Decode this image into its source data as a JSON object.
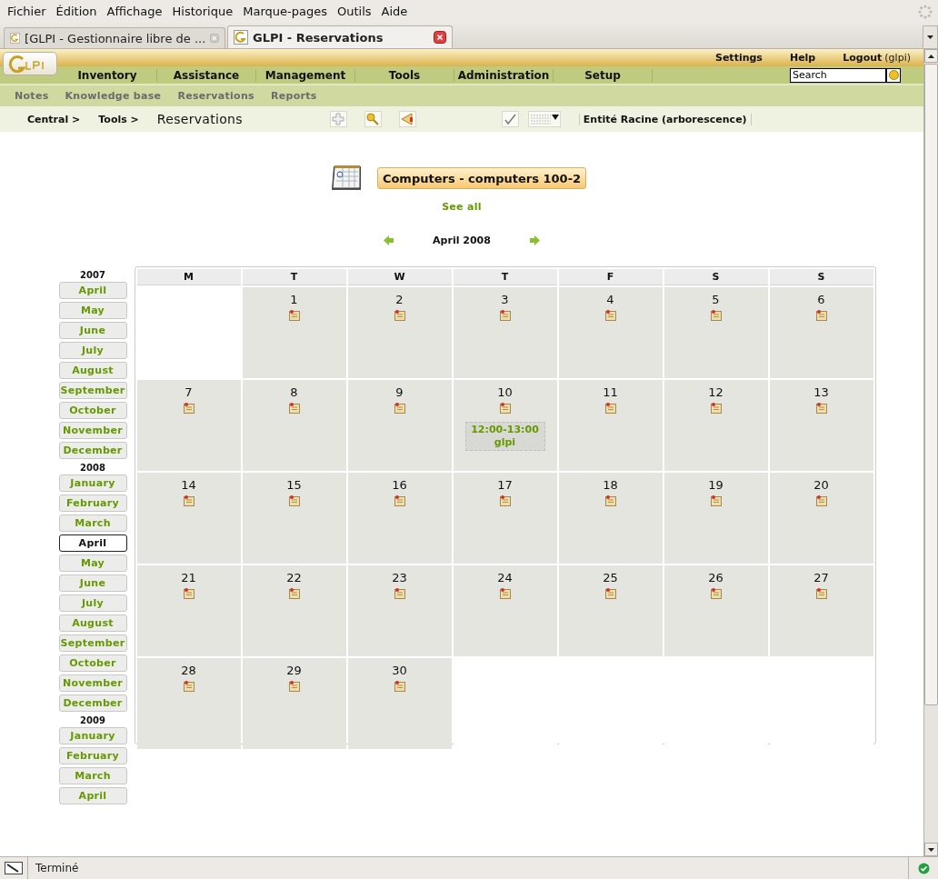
{
  "browser": {
    "menu": [
      "Fichier",
      "Édition",
      "Affichage",
      "Historique",
      "Marque-pages",
      "Outils",
      "Aide"
    ],
    "tabs": [
      {
        "title": "[GLPI - Gestionnaire libre de ...",
        "selected": false
      },
      {
        "title": "GLPI - Reservations",
        "selected": true
      }
    ],
    "status": "Terminé"
  },
  "header": {
    "top_links": [
      "Settings",
      "Help"
    ],
    "logout": "Logout",
    "user": "(glpi)",
    "menu": [
      "Inventory",
      "Assistance",
      "Management",
      "Tools",
      "Administration",
      "Setup"
    ],
    "search": {
      "value": "Search"
    },
    "submenu": [
      "Notes",
      "Knowledge base",
      "Reservations",
      "Reports"
    ]
  },
  "breadcrumb": [
    "Central >",
    "Tools >"
  ],
  "page_title": "Reservations",
  "entity": "Entité Racine (arborescence)",
  "item_button": "Computers - computers 100-2",
  "see_all": "See all",
  "month_title": "April 2008",
  "years": [
    {
      "year": "2007",
      "months": [
        {
          "label": "April",
          "selected": false
        },
        {
          "label": "May",
          "selected": false
        },
        {
          "label": "June",
          "selected": false
        },
        {
          "label": "July",
          "selected": false
        },
        {
          "label": "August",
          "selected": false
        },
        {
          "label": "September",
          "selected": false
        },
        {
          "label": "October",
          "selected": false
        },
        {
          "label": "November",
          "selected": false
        },
        {
          "label": "December",
          "selected": false
        }
      ]
    },
    {
      "year": "2008",
      "months": [
        {
          "label": "January",
          "selected": false
        },
        {
          "label": "February",
          "selected": false
        },
        {
          "label": "March",
          "selected": false
        },
        {
          "label": "April",
          "selected": true
        },
        {
          "label": "May",
          "selected": false
        },
        {
          "label": "June",
          "selected": false
        },
        {
          "label": "July",
          "selected": false
        },
        {
          "label": "August",
          "selected": false
        },
        {
          "label": "September",
          "selected": false
        },
        {
          "label": "October",
          "selected": false
        },
        {
          "label": "November",
          "selected": false
        },
        {
          "label": "December",
          "selected": false
        }
      ]
    },
    {
      "year": "2009",
      "months": [
        {
          "label": "January",
          "selected": false
        },
        {
          "label": "February",
          "selected": false
        },
        {
          "label": "March",
          "selected": false
        },
        {
          "label": "April",
          "selected": false
        }
      ]
    }
  ],
  "weekdays": [
    "M",
    "T",
    "W",
    "T",
    "F",
    "S",
    "S"
  ],
  "cells": [
    {
      "kind": "blank"
    },
    {
      "kind": "day",
      "day": "1"
    },
    {
      "kind": "day",
      "day": "2"
    },
    {
      "kind": "day",
      "day": "3"
    },
    {
      "kind": "day",
      "day": "4"
    },
    {
      "kind": "day",
      "day": "5"
    },
    {
      "kind": "day",
      "day": "6"
    },
    {
      "kind": "day",
      "day": "7"
    },
    {
      "kind": "day",
      "day": "8"
    },
    {
      "kind": "day",
      "day": "9"
    },
    {
      "kind": "day",
      "day": "10",
      "reservations": [
        {
          "time": "12:00-13:00",
          "user": "glpi"
        }
      ]
    },
    {
      "kind": "day",
      "day": "11"
    },
    {
      "kind": "day",
      "day": "12"
    },
    {
      "kind": "day",
      "day": "13"
    },
    {
      "kind": "day",
      "day": "14"
    },
    {
      "kind": "day",
      "day": "15"
    },
    {
      "kind": "day",
      "day": "16"
    },
    {
      "kind": "day",
      "day": "17"
    },
    {
      "kind": "day",
      "day": "18"
    },
    {
      "kind": "day",
      "day": "19"
    },
    {
      "kind": "day",
      "day": "20"
    },
    {
      "kind": "day",
      "day": "21"
    },
    {
      "kind": "day",
      "day": "22"
    },
    {
      "kind": "day",
      "day": "23"
    },
    {
      "kind": "day",
      "day": "24"
    },
    {
      "kind": "day",
      "day": "25"
    },
    {
      "kind": "day",
      "day": "26"
    },
    {
      "kind": "day",
      "day": "27"
    },
    {
      "kind": "day",
      "day": "28"
    },
    {
      "kind": "day",
      "day": "29"
    },
    {
      "kind": "day",
      "day": "30"
    },
    {
      "kind": "blank"
    },
    {
      "kind": "blank"
    },
    {
      "kind": "blank"
    },
    {
      "kind": "blank"
    }
  ]
}
